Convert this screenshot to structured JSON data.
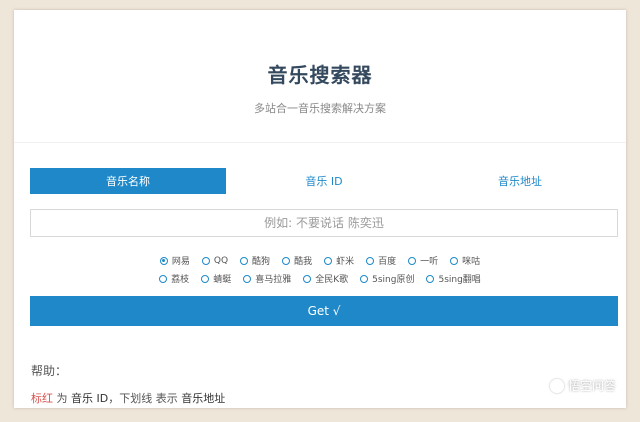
{
  "header": {
    "title": "音乐搜索器",
    "subtitle": "多站合一音乐搜索解决方案"
  },
  "tabs": [
    {
      "label": "音乐名称",
      "active": true
    },
    {
      "label": "音乐 ID",
      "active": false
    },
    {
      "label": "音乐地址",
      "active": false
    }
  ],
  "search": {
    "value": "",
    "placeholder": "例如: 不要说话 陈奕迅"
  },
  "sources": {
    "selected": "网易",
    "row1": [
      "网易",
      "QQ",
      "酷狗",
      "酷我",
      "虾米",
      "百度",
      "一听",
      "咪咕"
    ],
    "row2": [
      "荔枝",
      "蜻蜓",
      "喜马拉雅",
      "全民K歌",
      "5sing原创",
      "5sing翻唱"
    ]
  },
  "submit": {
    "label": "Get √"
  },
  "help": {
    "title": "帮助：",
    "line_red": "标红",
    "line_mid": " 为 ",
    "line_strong1": "音乐 ID",
    "line_mid2": "，下划线 表示 ",
    "line_strong2": "音乐地址"
  },
  "watermark": {
    "text": "悟空问答",
    "icon": "chat-bubble-icon"
  },
  "colors": {
    "accent": "#1e88c9",
    "background": "#efe6da",
    "title": "#34495e"
  }
}
